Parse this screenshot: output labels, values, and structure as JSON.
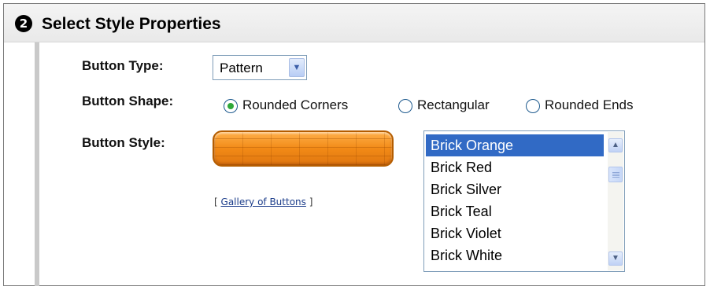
{
  "section": {
    "step_number": "❷",
    "title": "Select Style Properties"
  },
  "button_type": {
    "label": "Button Type:",
    "selected": "Pattern",
    "dropdown_icon": "chevron-down-icon"
  },
  "button_shape": {
    "label": "Button Shape:",
    "options": [
      {
        "label": "Rounded Corners",
        "checked": true
      },
      {
        "label": "Rectangular",
        "checked": false
      },
      {
        "label": "Rounded Ends",
        "checked": false
      }
    ]
  },
  "button_style": {
    "label": "Button Style:",
    "preview_color": "#f28a16",
    "gallery_prefix": "[",
    "gallery_link": "Gallery of Buttons",
    "gallery_suffix": "]",
    "styles": [
      "Brick Orange",
      "Brick Red",
      "Brick Silver",
      "Brick Teal",
      "Brick Violet",
      "Brick White"
    ],
    "selected_index": 0
  },
  "colors": {
    "selection": "#316ac5",
    "radio_dot": "#2fa83a",
    "header_bg": "#efefef"
  }
}
